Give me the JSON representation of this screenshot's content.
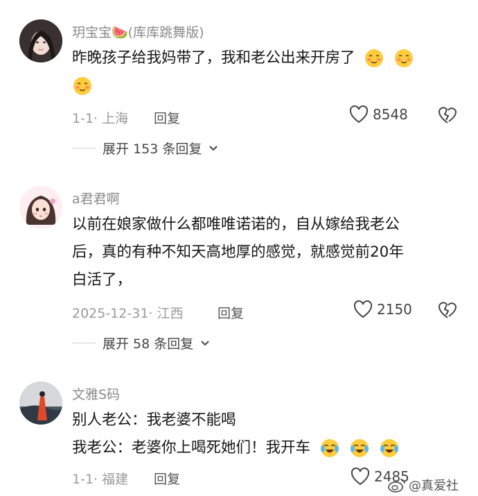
{
  "comments": [
    {
      "username": "玥宝宝🍉(库库跳舞版)",
      "text_lines": [
        "昨晚孩子给我妈带了，我和老公出来开房了"
      ],
      "meta": "1-1· 上海",
      "reply_label": "回复",
      "likes": "8548",
      "expand_label": "展开 153 条回复"
    },
    {
      "username": "a君君啊",
      "text_lines": [
        "以前在娘家做什么都唯唯诺诺的，自从嫁给我老公",
        "后，真的有种不知天高地厚的感觉，就感觉前20年",
        "白活了，"
      ],
      "meta": "2025-12-31· 江西",
      "reply_label": "回复",
      "likes": "2150",
      "expand_label": "展开 58 条回复"
    },
    {
      "username": "文雅S码",
      "text_lines": [
        "别人老公：我老婆不能喝",
        "我老公：老婆你上喝死她们！我开车"
      ],
      "meta": "1-1· 福建",
      "reply_label": "回复",
      "likes": "2485"
    }
  ],
  "watermark": "@真爱社",
  "icons": {
    "like": "heart-outline-icon",
    "dislike": "broken-heart-icon",
    "expand": "chevron-down-icon",
    "emoji_1": "shy-smile-emoji-icon",
    "emoji_2": "laugh-cry-emoji-icon",
    "watermark": "weibo-logo-icon"
  }
}
